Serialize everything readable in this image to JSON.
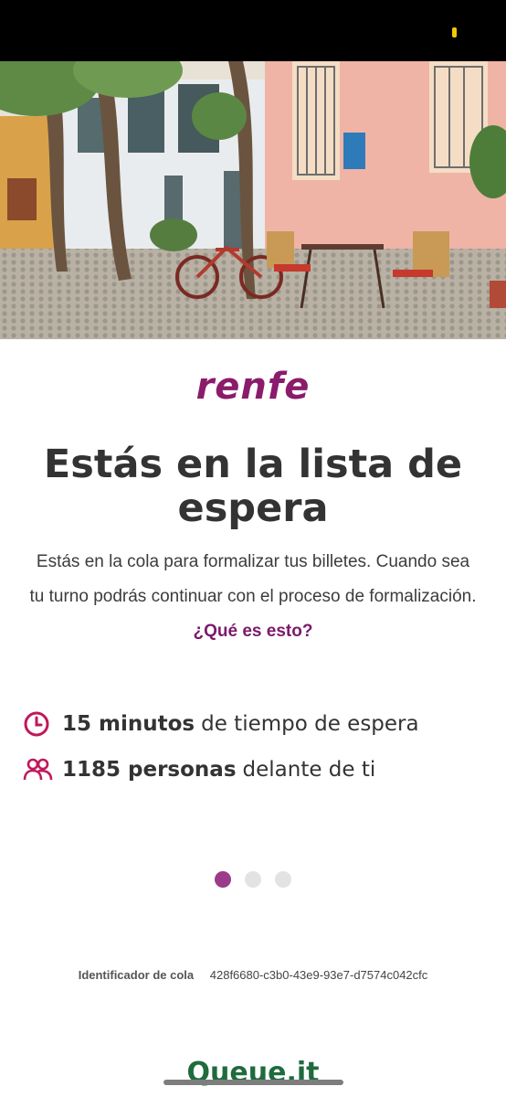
{
  "brand": {
    "logo_text": "renfe"
  },
  "page": {
    "title": "Estás en la lista de espera",
    "description": "Estás en la cola para formalizar tus billetes. Cuando sea tu turno podrás continuar con el proceso de formalización.",
    "help_link": "¿Qué es esto?"
  },
  "stats": {
    "wait": {
      "value": "15 minutos",
      "suffix": "de tiempo de espera",
      "icon": "clock-icon"
    },
    "people": {
      "value": "1185 personas",
      "suffix": "delante de ti",
      "icon": "people-icon"
    }
  },
  "pager": {
    "count": 3,
    "active_index": 0
  },
  "queue": {
    "label": "Identificador de cola",
    "id": "428f6680-c3b0-43e9-93e7-d7574c042cfc"
  },
  "footer": {
    "brand": "Queue.it"
  },
  "colors": {
    "brand": "#8a1c6b",
    "accent": "#9b3b8b",
    "icon": "#c0185c",
    "footer_brand": "#1f6b3d",
    "status_indicator": "#f5c800"
  }
}
